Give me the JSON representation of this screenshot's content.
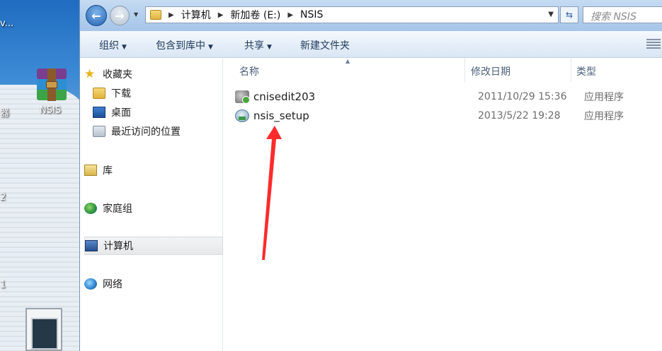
{
  "desktop": {
    "labels": [
      "v...",
      "器",
      "2",
      "1"
    ],
    "icon_label": "NSIS"
  },
  "window": {
    "address": {
      "crumbs": [
        "计算机",
        "新加卷 (E:)",
        "NSIS"
      ]
    },
    "search_placeholder": "搜索 NSIS",
    "toolbar": {
      "organize": "组织",
      "include_library": "包含到库中",
      "share": "共享",
      "new_folder": "新建文件夹"
    },
    "nav": {
      "favorites": "收藏夹",
      "downloads": "下载",
      "desktop": "桌面",
      "recent": "最近访问的位置",
      "libraries": "库",
      "homegroup": "家庭组",
      "computer": "计算机",
      "network": "网络"
    },
    "columns": {
      "name": "名称",
      "modified": "修改日期",
      "type": "类型"
    },
    "files": [
      {
        "name": "cnisedit203",
        "modified": "2011/10/29 15:36",
        "type": "应用程序",
        "icon": "app-gear-icon"
      },
      {
        "name": "nsis_setup",
        "modified": "2013/5/22 19:28",
        "type": "应用程序",
        "icon": "installer-icon"
      }
    ]
  },
  "colors": {
    "annotation_arrow": "#ff2b2b",
    "selection": "#e7e8ea",
    "toolbar_text": "#1e395b"
  }
}
